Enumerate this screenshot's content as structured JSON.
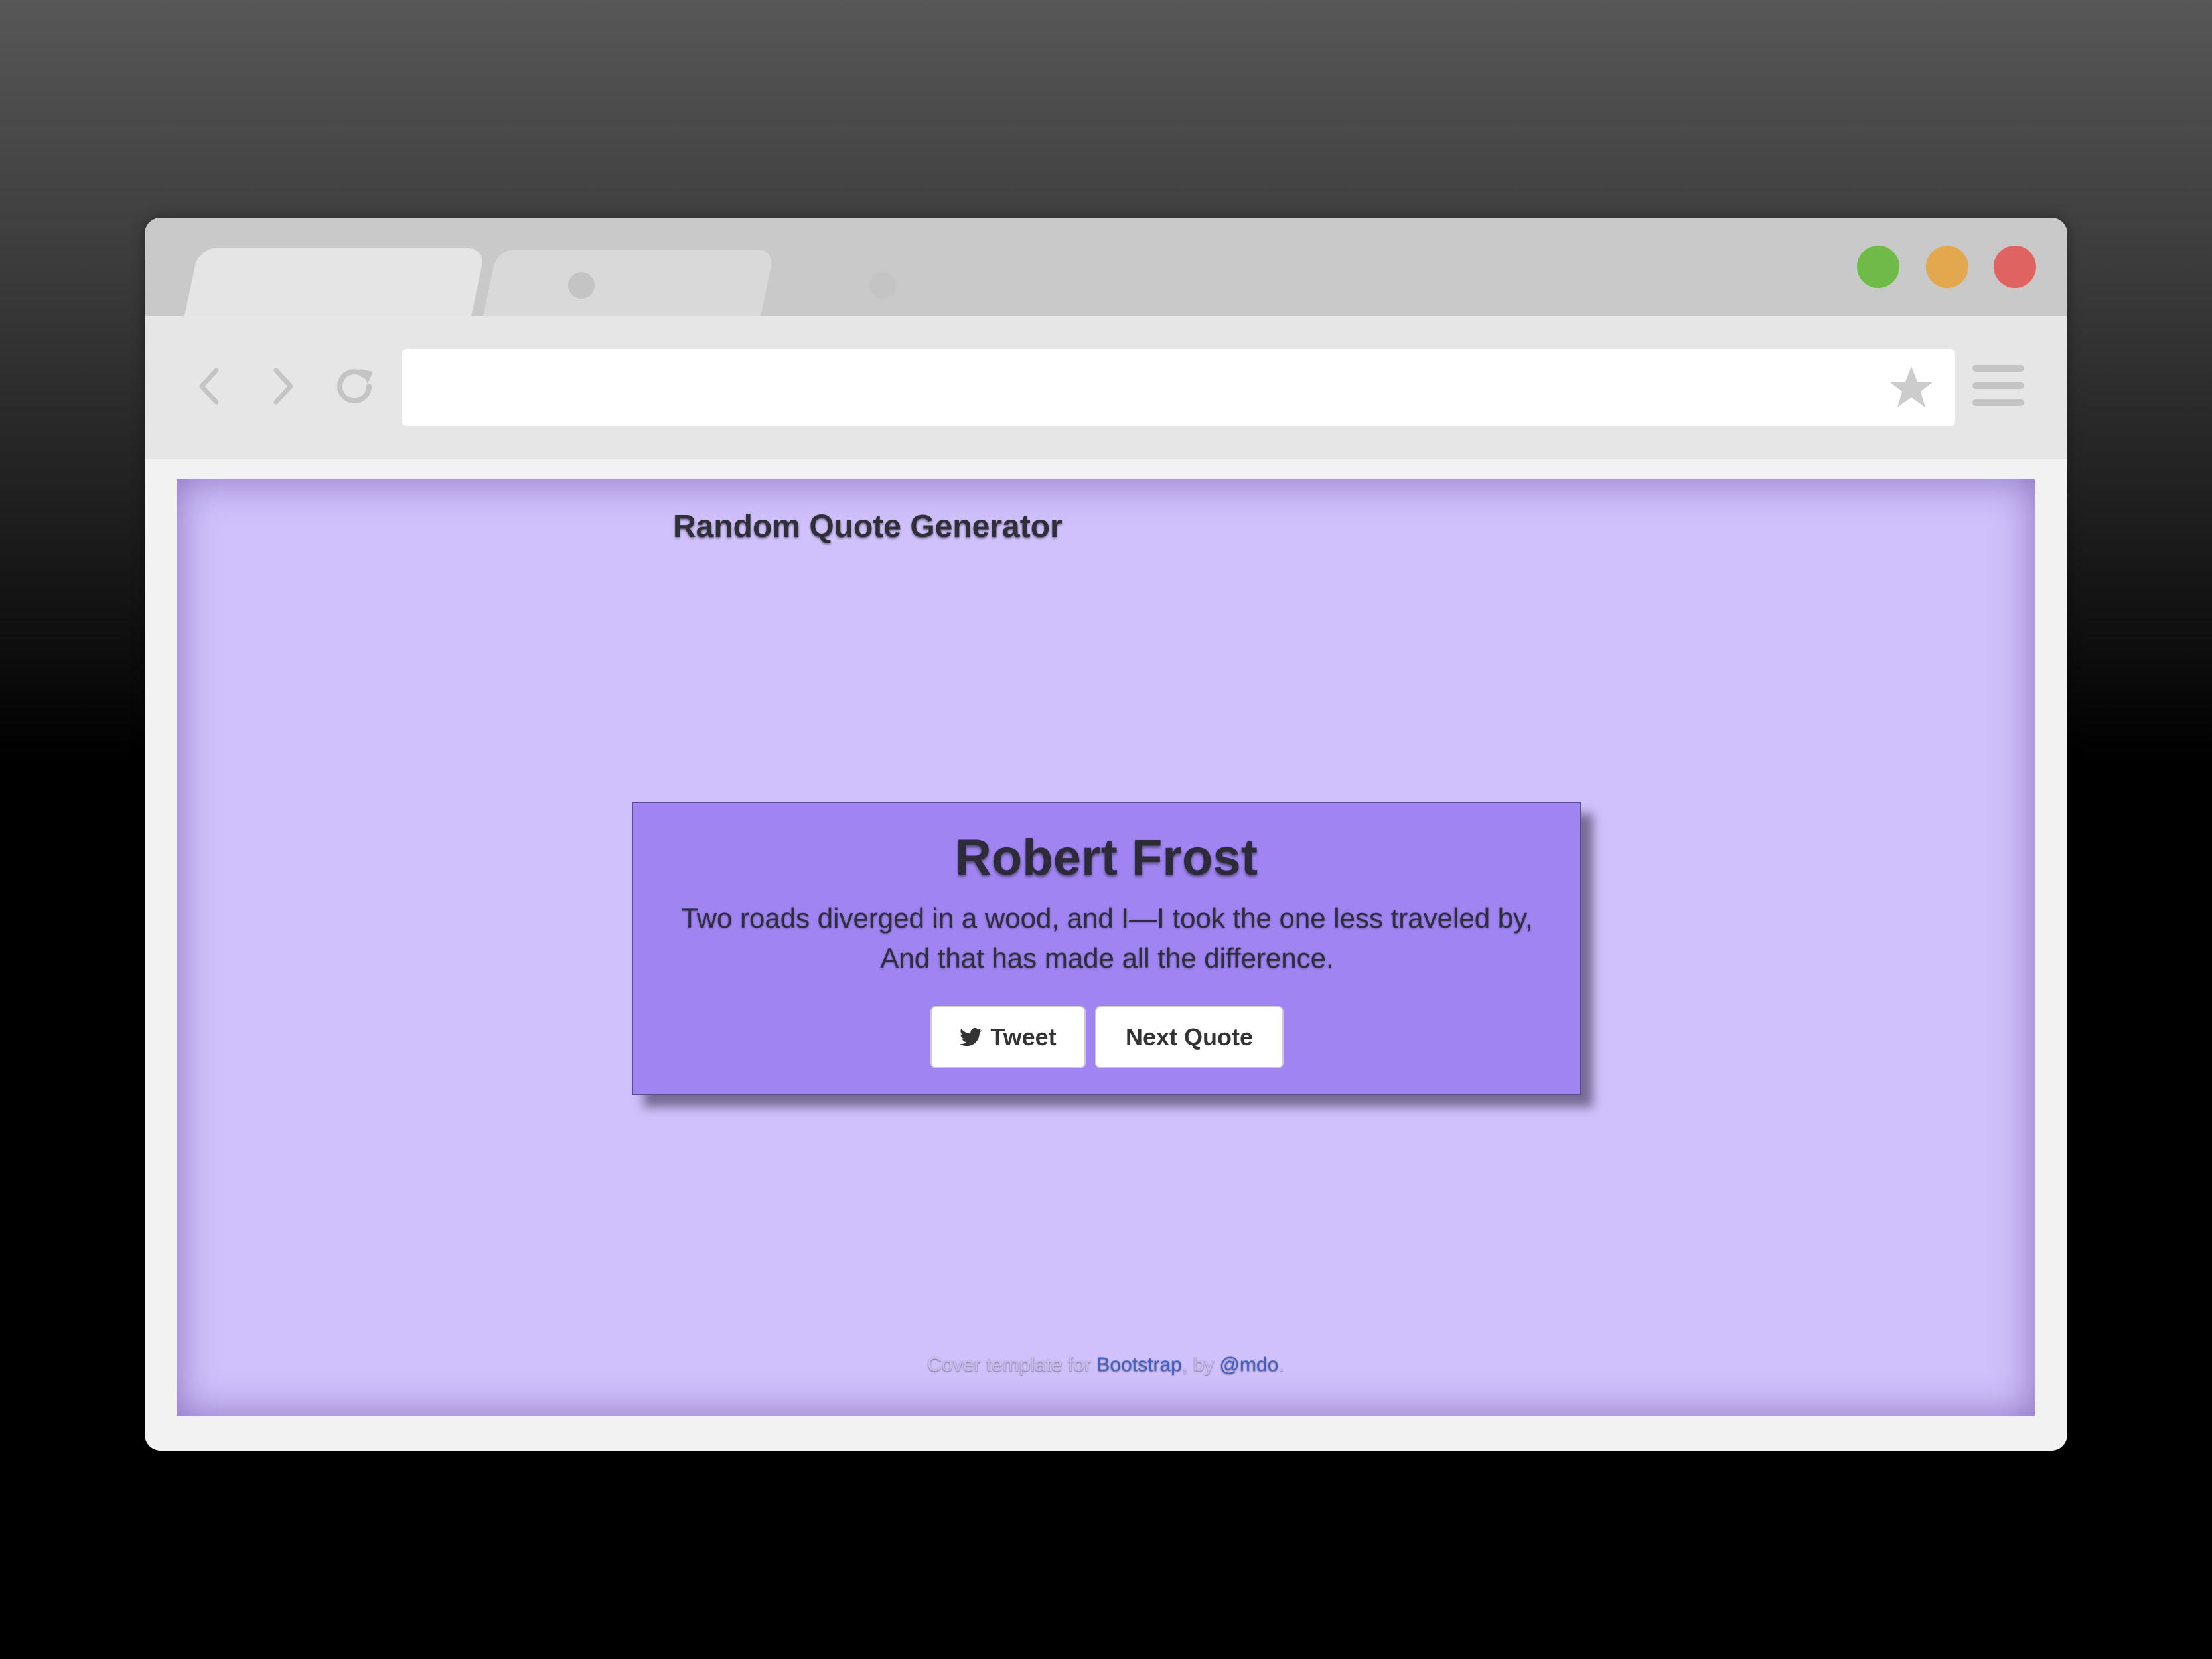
{
  "browser": {
    "tabs": [
      {
        "state": "active",
        "close_icon": "tab-close-dot"
      },
      {
        "state": "inactive",
        "close_icon": "tab-close-dot"
      }
    ],
    "window_controls": {
      "green": "#6fba48",
      "yellow": "#e3a74e",
      "red": "#de6361"
    },
    "toolbar": {
      "back_icon": "chevron-left-icon",
      "forward_icon": "chevron-right-icon",
      "reload_icon": "reload-icon",
      "bookmark_icon": "star-icon",
      "menu_icon": "hamburger-menu-icon"
    },
    "address_bar": {
      "value": ""
    }
  },
  "page": {
    "background_color": "#d0c0fb",
    "title": "Random Quote Generator",
    "quote_card": {
      "background_color": "#a085f2",
      "author": "Robert Frost",
      "text": "Two roads diverged in a wood, and I—I took the one less traveled by, And that has made all the difference.",
      "buttons": {
        "tweet_label": "Tweet",
        "tweet_icon": "twitter-icon",
        "next_label": "Next Quote"
      }
    },
    "footer": {
      "prefix": "Cover template for ",
      "bootstrap_link": "Bootstrap",
      "middle": ", by ",
      "author_link": "@mdo",
      "suffix": ".",
      "link_color": "#3e60c0"
    }
  }
}
